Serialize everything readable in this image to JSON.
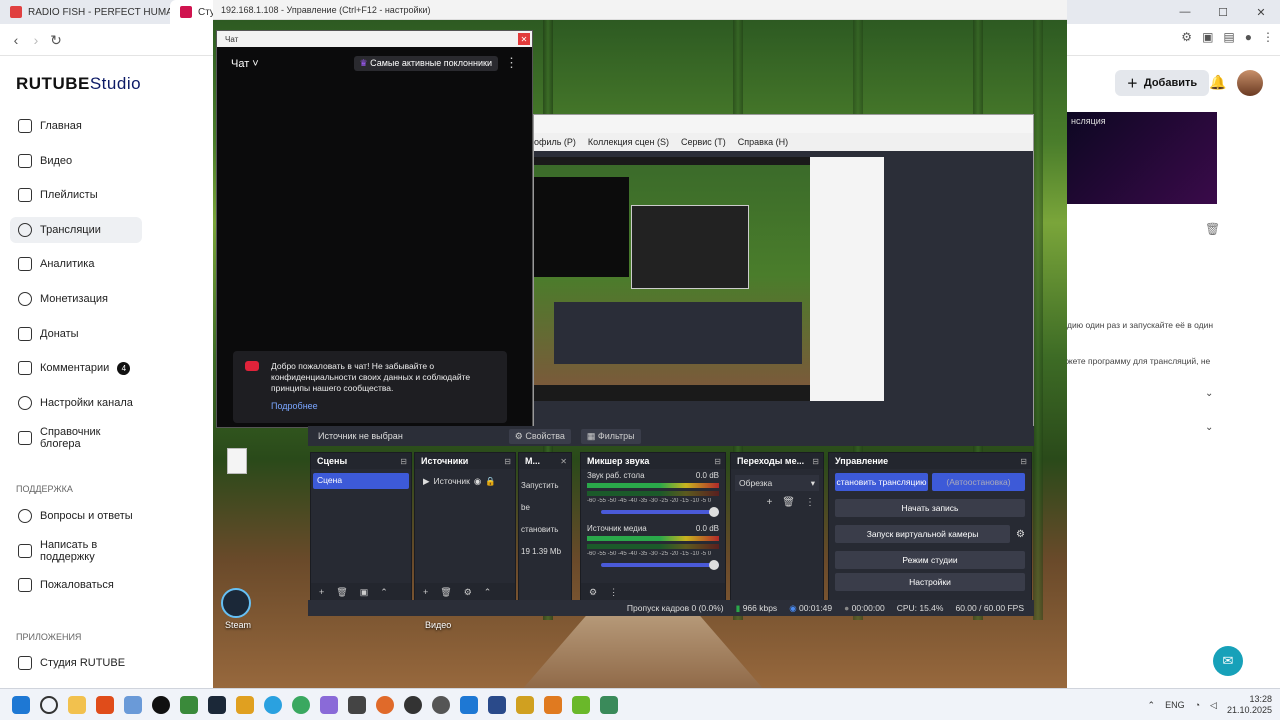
{
  "browser": {
    "tabs": [
      {
        "title": "RADIO FISH - PERFECT HUMAN (feat...",
        "color": "#e04040"
      },
      {
        "title": "Студи",
        "color": "#d0144f"
      }
    ],
    "window_controls": [
      "—",
      "☐",
      "✕"
    ]
  },
  "rdp": {
    "title": "192.168.1.108 - Управление     (Ctrl+F12 - настройки)"
  },
  "sidebar": {
    "logo_main": "RUTUBE",
    "logo_studio": "Studio",
    "items": [
      {
        "label": "Главная",
        "icon": "home-icon"
      },
      {
        "label": "Видео",
        "icon": "video-icon"
      },
      {
        "label": "Плейлисты",
        "icon": "playlist-icon"
      },
      {
        "label": "Трансляции",
        "icon": "broadcast-icon"
      },
      {
        "label": "Аналитика",
        "icon": "analytics-icon"
      },
      {
        "label": "Монетизация",
        "icon": "monetization-icon"
      },
      {
        "label": "Донаты",
        "icon": "donate-icon"
      },
      {
        "label": "Комментарии",
        "icon": "comments-icon",
        "badge": "4"
      },
      {
        "label": "Настройки канала",
        "icon": "settings-icon"
      },
      {
        "label": "Справочник блогера",
        "icon": "guide-icon"
      }
    ],
    "support_title": "ПОДДЕРЖКА",
    "support_items": [
      {
        "label": "Вопросы и ответы",
        "icon": "faq-icon"
      },
      {
        "label": "Написать в поддержку",
        "icon": "support-icon"
      },
      {
        "label": "Пожаловаться",
        "icon": "flag-icon"
      }
    ],
    "apps_title": "ПРИЛОЖЕНИЯ",
    "apps_items": [
      {
        "label": "Студия RUTUBE",
        "icon": "app-icon"
      }
    ]
  },
  "chat": {
    "window_title": "Чат",
    "header": "Чат ˅",
    "fans_button": "Самые активные поклонники",
    "welcome_text": "Добро пожаловать в чат! Не забывайте о конфиденциальности своих данных и соблюдайте принципы нашего сообщества.",
    "more_link": "Подробнее"
  },
  "obs": {
    "menu": [
      "офиль (P)",
      "Коллекция сцен (S)",
      "Сервис (T)",
      "Справка (H)"
    ],
    "source_bar": {
      "no_source": "Источник не выбран",
      "properties": "Свойства",
      "filters": "Фильтры"
    },
    "scenes": {
      "title": "Сцены",
      "items": [
        "Сцена"
      ]
    },
    "sources": {
      "title": "Источники",
      "items": [
        "Источник"
      ]
    },
    "media": {
      "title": "М...",
      "launch": "Запустить",
      "be": "be",
      "install": "становить",
      "size": "19  1.39 Mb"
    },
    "mixer": {
      "title": "Микшер звука",
      "channels": [
        {
          "name": "Звук раб. стола",
          "db": "0.0 dB"
        },
        {
          "name": "Источник медиа",
          "db": "0.0 dB"
        }
      ],
      "scale": "-60 -55 -50 -45 -40 -35 -30 -25 -20 -15 -10 -5 0"
    },
    "transitions": {
      "title": "Переходы ме...",
      "value": "Обрезка"
    },
    "controls": {
      "title": "Управление",
      "stop_stream": "становить трансляцию",
      "auto_stop": "(Автоостановка)",
      "record": "Начать запись",
      "virtual_cam": "Запуск виртуальной камеры",
      "studio_mode": "Режим студии",
      "settings": "Настройки"
    },
    "status": {
      "dropped": "Пропуск кадров 0 (0.0%)",
      "bitrate": "966 kbps",
      "stream_time": "00:01:49",
      "rec_time": "00:00:00",
      "cpu": "CPU: 15.4%",
      "fps": "60.00 / 60.00 FPS"
    }
  },
  "desktop_icons": [
    {
      "label": "Steam"
    },
    {
      "label": "Видео"
    }
  ],
  "right_panel": {
    "add_button": "Добавить",
    "card_text": "нсляция",
    "text_lines": [
      "дию один раз и запускайте её в один",
      "жете программу для трансляций, не"
    ]
  },
  "taskbar": {
    "lang": "ENG",
    "time": "13:28",
    "date": "21.10.2025"
  },
  "colors": {
    "accent_blue": "#3d5ad8",
    "rutube_pink": "#d0144f",
    "chat_bg": "#0b0b0c",
    "obs_bg": "#2b2e38"
  }
}
